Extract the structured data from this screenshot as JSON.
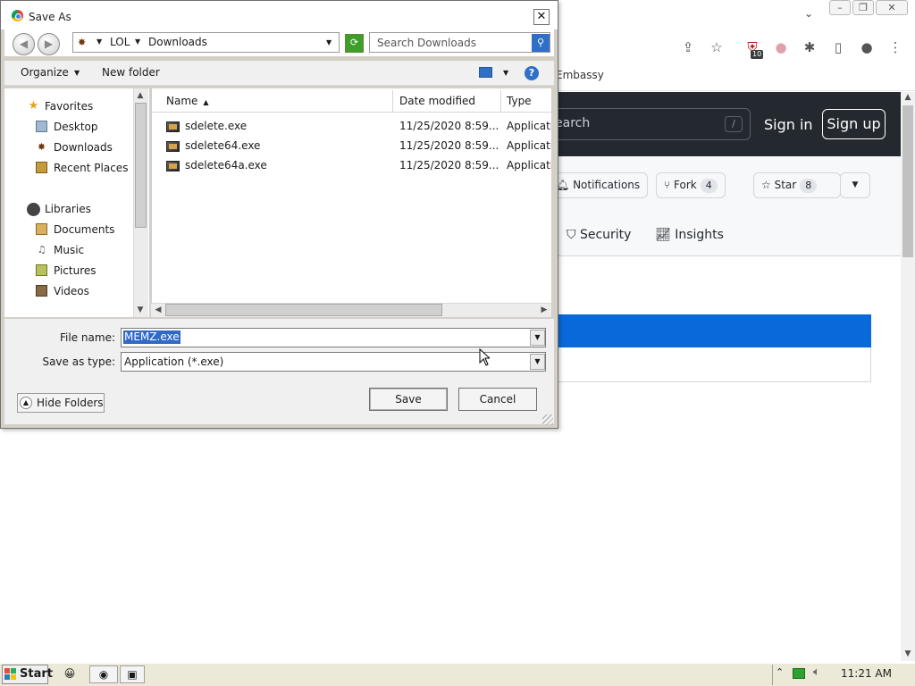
{
  "browser": {
    "bookmark_item": "Embassy",
    "extension_badge": "10",
    "window_controls": [
      "–",
      "❐",
      "✕"
    ],
    "github": {
      "search_placeholder": "earch",
      "search_shortcut": "/",
      "sign_in": "Sign in",
      "sign_up": "Sign up",
      "buttons": [
        {
          "label": "Notifications",
          "icon": "bell-icon"
        },
        {
          "label": "Fork",
          "count": "4",
          "icon": "fork-icon"
        },
        {
          "label": "Star",
          "count": "8",
          "icon": "star-icon"
        }
      ],
      "tabs": [
        {
          "label": "Security",
          "icon": "shield-icon"
        },
        {
          "label": "Insights",
          "icon": "graph-icon"
        }
      ],
      "colors": {
        "header": "#24292f",
        "blue_bar": "#0969da"
      }
    }
  },
  "dialog": {
    "title": "Save As",
    "close_glyph": "✕",
    "address": {
      "root": "LOL",
      "current": "Downloads"
    },
    "search_placeholder": "Search Downloads",
    "commands": {
      "organize": "Organize",
      "new_folder": "New folder",
      "help": "?"
    },
    "nav": {
      "favorites_header": "Favorites",
      "favorites": [
        "Desktop",
        "Downloads",
        "Recent Places"
      ],
      "libraries_header": "Libraries",
      "libraries": [
        "Documents",
        "Music",
        "Pictures",
        "Videos"
      ]
    },
    "columns": {
      "name": "Name",
      "date": "Date modified",
      "type": "Type"
    },
    "files": [
      {
        "name": "sdelete.exe",
        "date": "11/25/2020 8:59...",
        "type": "Applicati"
      },
      {
        "name": "sdelete64.exe",
        "date": "11/25/2020 8:59...",
        "type": "Applicati"
      },
      {
        "name": "sdelete64a.exe",
        "date": "11/25/2020 8:59...",
        "type": "Applicati"
      }
    ],
    "file_name_label": "File name:",
    "file_name_value": "MEMZ.exe",
    "save_type_label": "Save as type:",
    "save_type_value": "Application (*.exe)",
    "hide_folders": "Hide Folders",
    "save_button": "Save",
    "cancel_button": "Cancel"
  },
  "taskbar": {
    "start_label": "Start",
    "clock": "11:21 AM"
  }
}
